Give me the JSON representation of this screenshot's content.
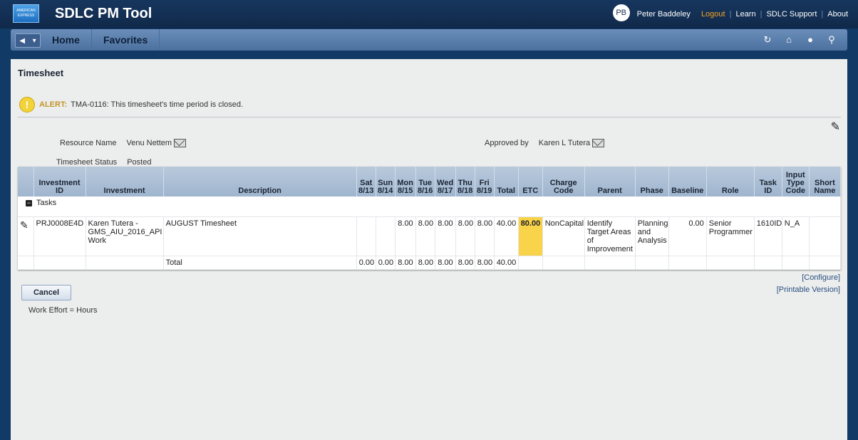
{
  "header": {
    "logo_text": "AMERICAN EXPRESS",
    "app_title": "SDLC PM Tool",
    "avatar_initials": "PB",
    "user_name": "Peter Baddeley",
    "logout": "Logout",
    "learn": "Learn",
    "support": "SDLC Support",
    "about": "About"
  },
  "nav": {
    "home": "Home",
    "favorites": "Favorites",
    "back_glyph": "◀",
    "dropdown_glyph": "▾",
    "icons": [
      "refresh-icon",
      "home-icon",
      "check-icon",
      "search-icon"
    ]
  },
  "page": {
    "title": "Timesheet",
    "alert_label": "ALERT:",
    "alert_text": "TMA-0116: This timesheet's time period is closed.",
    "resource_label": "Resource Name",
    "resource_value": "Venu Nettem",
    "approved_label": "Approved by",
    "approved_value": "Karen L Tutera",
    "status_label": "Timesheet Status",
    "status_value": "Posted"
  },
  "table": {
    "headers": {
      "investment_id": "Investment ID",
      "investment": "Investment",
      "description": "Description",
      "sat": "Sat 8/13",
      "sun": "Sun 8/14",
      "mon": "Mon 8/15",
      "tue": "Tue 8/16",
      "wed": "Wed 8/17",
      "thu": "Thu 8/18",
      "fri": "Fri 8/19",
      "total": "Total",
      "etc": "ETC",
      "charge_code": "Charge Code",
      "parent": "Parent",
      "phase": "Phase",
      "baseline": "Baseline",
      "role": "Role",
      "task_id": "Task ID",
      "input_type_code": "Input Type Code",
      "short_name": "Short Name"
    },
    "group_label": "Tasks",
    "row": {
      "investment_id": "PRJ0008E4D",
      "investment": "Karen Tutera - GMS_AIU_2016_API Work",
      "description": "AUGUST Timesheet",
      "sat": "",
      "sun": "",
      "mon": "8.00",
      "tue": "8.00",
      "wed": "8.00",
      "thu": "8.00",
      "fri": "8.00",
      "total": "40.00",
      "etc": "80.00",
      "charge_code": "NonCapital",
      "parent": "Identify Target Areas of Improvement",
      "phase": "Planning and Analysis",
      "baseline": "0.00",
      "role": "Senior Programmer",
      "task_id": "1610ID",
      "input_type_code": "N_A",
      "short_name": ""
    },
    "totals": {
      "label": "Total",
      "sat": "0.00",
      "sun": "0.00",
      "mon": "8.00",
      "tue": "8.00",
      "wed": "8.00",
      "thu": "8.00",
      "fri": "8.00",
      "total": "40.00"
    }
  },
  "footer": {
    "configure": "[Configure]",
    "printable": "[Printable Version]",
    "cancel": "Cancel",
    "note": "Work Effort = Hours"
  }
}
